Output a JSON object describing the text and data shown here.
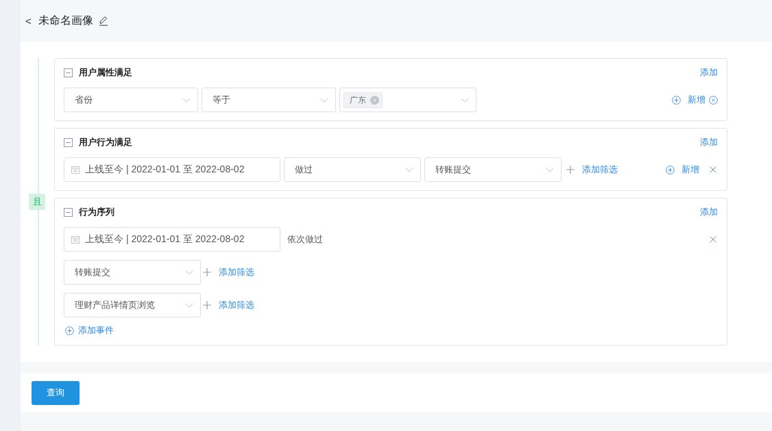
{
  "header": {
    "back": "<",
    "title": "未命名画像"
  },
  "logic_label": "且",
  "groups": [
    {
      "kind": "attribute",
      "title": "用户属性满足",
      "add_link": "添加",
      "selects": [
        "省份",
        "等于"
      ],
      "tags": [
        "广东"
      ],
      "new_link": "新增"
    },
    {
      "kind": "behavior",
      "title": "用户行为满足",
      "add_link": "添加",
      "date_range": "上线至今 | 2022-01-01 至 2022-08-02",
      "selects": [
        "做过",
        "转账提交"
      ],
      "filter_link": "添加筛选",
      "new_link": "新增"
    },
    {
      "kind": "sequence",
      "title": "行为序列",
      "add_link": "添加",
      "date_range": "上线至今 | 2022-01-01 至 2022-08-02",
      "order_text": "依次做过",
      "events": [
        {
          "name": "转账提交",
          "filter_link": "添加筛选"
        },
        {
          "name": "理财产品详情页浏览",
          "filter_link": "添加筛选"
        }
      ],
      "add_event": "添加事件"
    }
  ],
  "query_button": "查询"
}
